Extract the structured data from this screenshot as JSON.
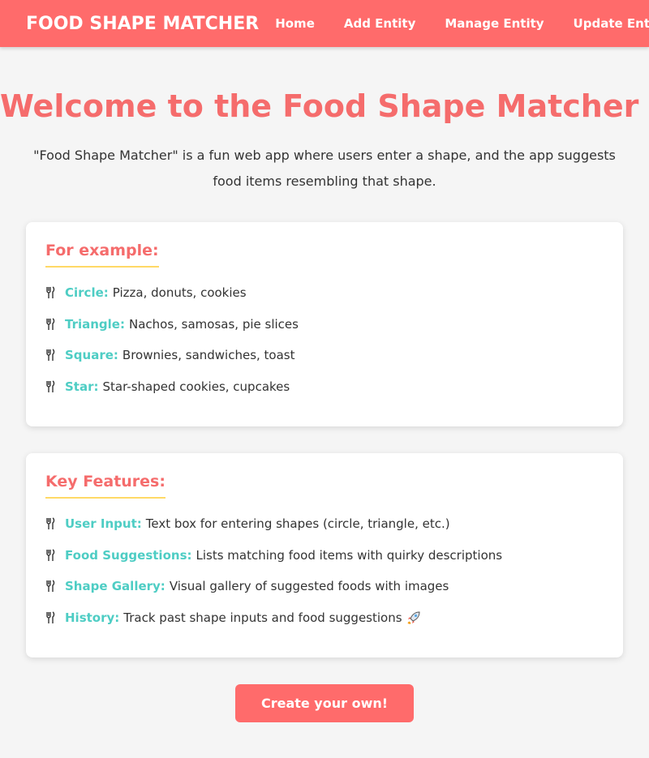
{
  "nav": {
    "brand": "FOOD SHAPE MATCHER",
    "links": [
      "Home",
      "Add Entity",
      "Manage Entity",
      "Update Entity"
    ]
  },
  "hero": {
    "title": "Welcome to the Food Shape Matcher",
    "title_icon": "pizza-icon",
    "intro": "\"Food Shape Matcher\" is a fun web app where users enter a shape, and the app suggests food items resembling that shape."
  },
  "examples": {
    "title": "For example:",
    "items": [
      {
        "label": "Circle:",
        "text": "Pizza, donuts, cookies"
      },
      {
        "label": "Triangle:",
        "text": "Nachos, samosas, pie slices"
      },
      {
        "label": "Square:",
        "text": "Brownies, sandwiches, toast"
      },
      {
        "label": "Star:",
        "text": "Star-shaped cookies, cupcakes"
      }
    ]
  },
  "features": {
    "title": "Key Features:",
    "items": [
      {
        "label": "User Input:",
        "text": "Text box for entering shapes (circle, triangle, etc.)"
      },
      {
        "label": "Food Suggestions:",
        "text": "Lists matching food items with quirky descriptions"
      },
      {
        "label": "Shape Gallery:",
        "text": "Visual gallery of suggested foods with images"
      },
      {
        "label": "History:",
        "text": "Track past shape inputs and food suggestions",
        "icon": "rocket-icon"
      }
    ]
  },
  "cta": {
    "label": "Create your own!"
  },
  "colors": {
    "primary": "#ff6b6b",
    "title": "#f56c6c",
    "accent": "#4ecdc4",
    "underline": "#ffd966",
    "background": "#f5f5f5"
  }
}
